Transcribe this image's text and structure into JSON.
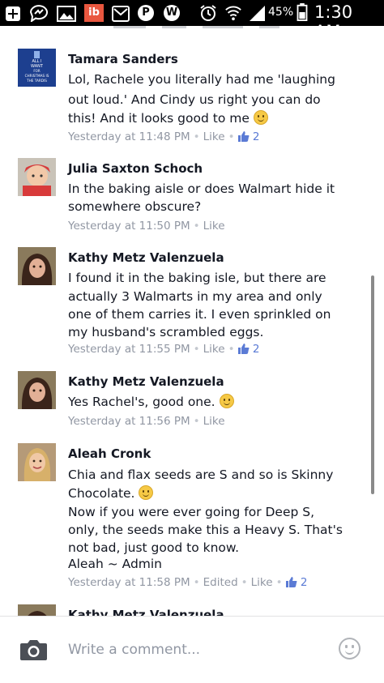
{
  "status_bar": {
    "battery_percent": "45%",
    "time": "1:30 AM",
    "app_badge": "ib",
    "icons": [
      "add-icon",
      "messenger-icon",
      "picture-icon",
      "ib-app-icon",
      "gmail-icon",
      "pinterest-icon",
      "wattpad-icon",
      "alarm-icon",
      "wifi-icon",
      "signal-icon",
      "battery-icon"
    ]
  },
  "comments": [
    {
      "author": "Tamara Sanders",
      "avatar_caption": [
        "ALL I",
        "WANT",
        "FOR",
        "CHRISTMAS IS",
        "THE TARDIS"
      ],
      "lines": [
        "Lol, Rachele you literally had me 'laughing",
        "out loud.' And Cindy us right you can do",
        "this! And it looks good to me"
      ],
      "time": "Yesterday at 11:48 PM",
      "like_label": "Like",
      "like_count": "2"
    },
    {
      "author": "Julia Saxton Schoch",
      "lines": [
        "In the baking aisle or does Walmart hide it",
        "somewhere obscure?"
      ],
      "time": "Yesterday at 11:50 PM",
      "like_label": "Like"
    },
    {
      "author": "Kathy Metz Valenzuela",
      "lines": [
        "I found it in the baking isle, but there are",
        "actually 3 Walmarts in my area and only",
        "one of them carries it. I even sprinkled on",
        "my husband's scrambled eggs."
      ],
      "time": "Yesterday at 11:55 PM",
      "like_label": "Like",
      "like_count": "2"
    },
    {
      "author": "Kathy Metz Valenzuela",
      "lines": [
        "Yes Rachel's, good one."
      ],
      "time": "Yesterday at 11:56 PM",
      "like_label": "Like"
    },
    {
      "author": "Aleah Cronk",
      "lines": [
        "Chia and flax seeds are S and so is Skinny",
        "Chocolate.",
        "Now if you were ever going for Deep S,",
        "only, the seeds make this a Heavy S. That's",
        "not bad, just good to know.",
        "Aleah ~ Admin"
      ],
      "time": "Yesterday at 11:58 PM",
      "edited_label": "Edited",
      "like_label": "Like",
      "like_count": "2"
    },
    {
      "author": "Kathy Metz Valenzuela"
    }
  ],
  "compose": {
    "placeholder": "Write a comment...",
    "icons": [
      "camera-icon",
      "emoji-icon"
    ]
  },
  "colors": {
    "status_bar": "#000000",
    "meta_text": "#9197a3",
    "like_count": "#5b7bd5",
    "name_text": "#141823"
  }
}
